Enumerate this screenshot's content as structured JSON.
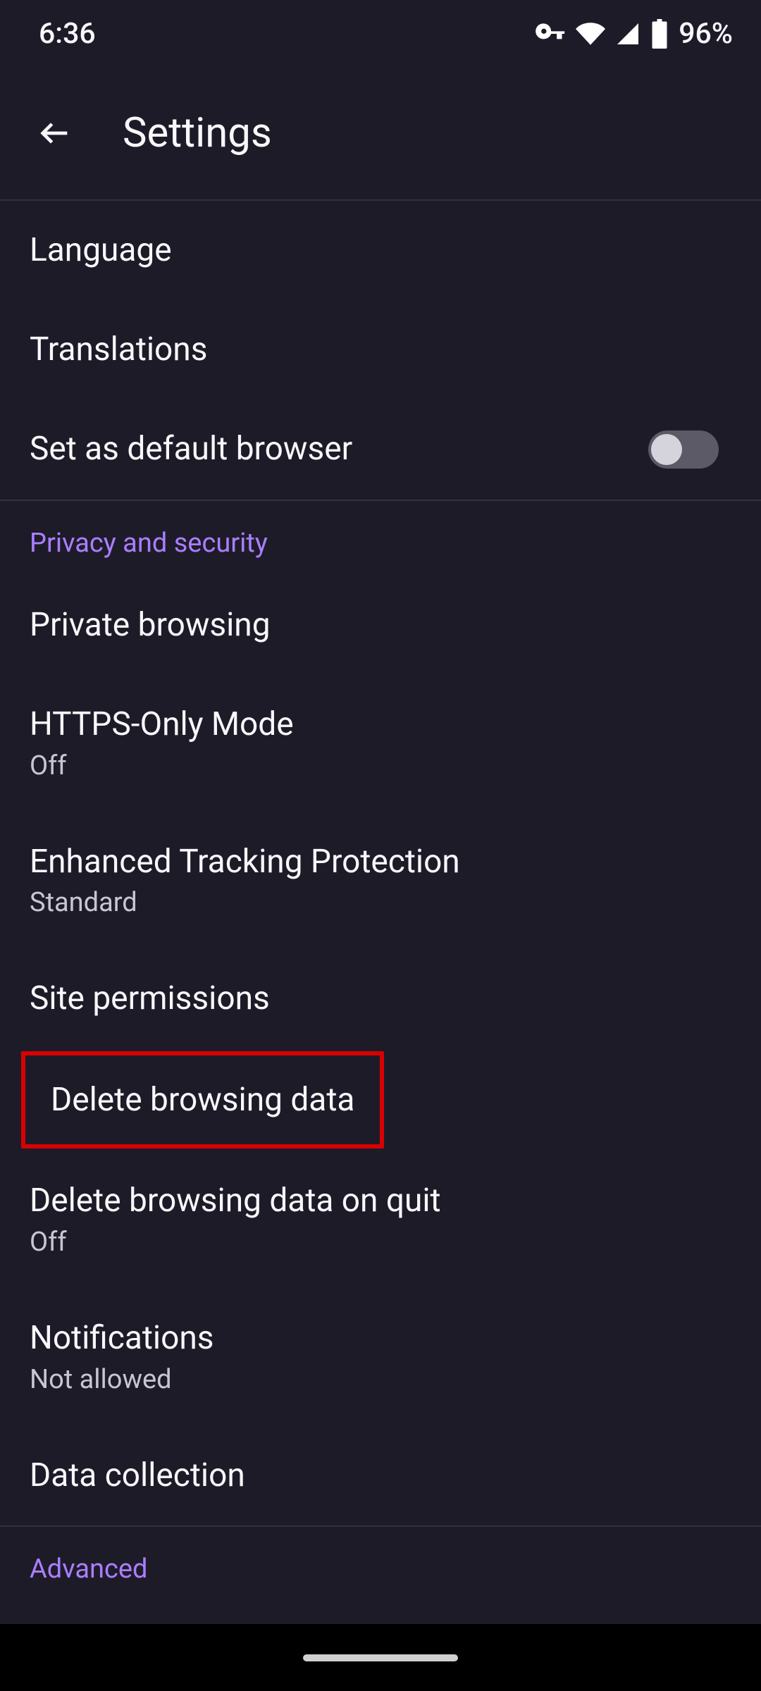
{
  "statusbar": {
    "time": "6:36",
    "battery_pct": "96%"
  },
  "header": {
    "title": "Settings"
  },
  "list": {
    "language": {
      "label": "Language"
    },
    "translations": {
      "label": "Translations"
    },
    "default_browser": {
      "label": "Set as default browser",
      "value": false
    },
    "section_privacy": "Privacy and security",
    "private_browsing": {
      "label": "Private browsing"
    },
    "https_only": {
      "label": "HTTPS-Only Mode",
      "sub": "Off"
    },
    "etp": {
      "label": "Enhanced Tracking Protection",
      "sub": "Standard"
    },
    "site_permissions": {
      "label": "Site permissions"
    },
    "delete_data": {
      "label": "Delete browsing data"
    },
    "delete_on_quit": {
      "label": "Delete browsing data on quit",
      "sub": "Off"
    },
    "notifications": {
      "label": "Notifications",
      "sub": "Not allowed"
    },
    "data_collection": {
      "label": "Data collection"
    },
    "section_advanced": "Advanced"
  }
}
